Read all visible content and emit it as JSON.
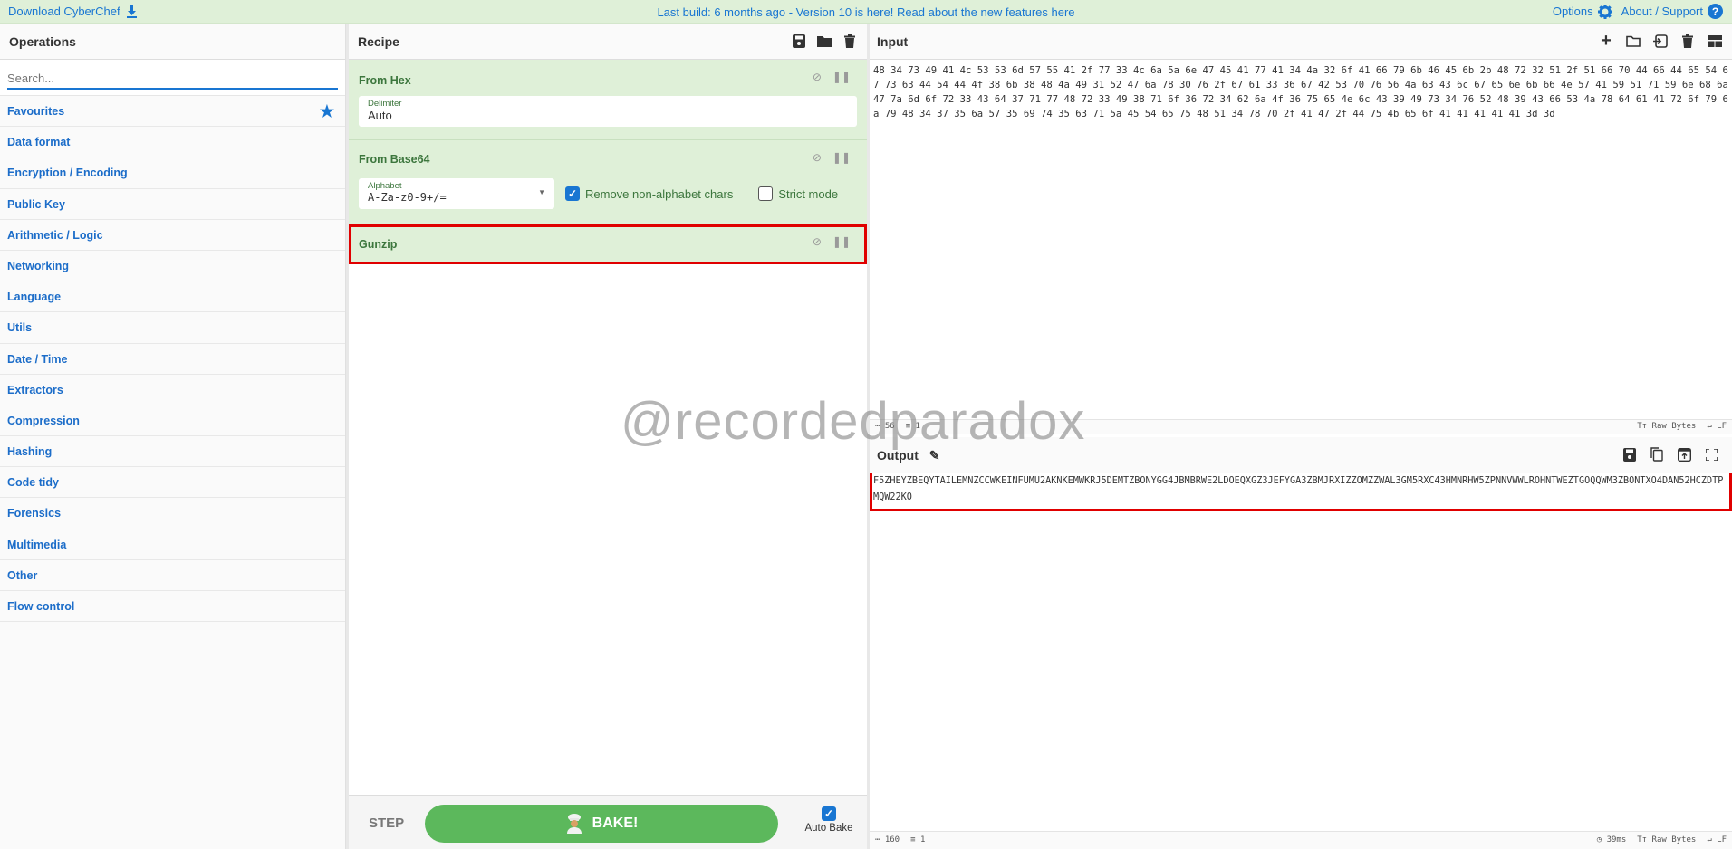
{
  "topbar": {
    "download_label": "Download CyberChef",
    "notice": "Last build: 6 months ago - Version 10 is here! Read about the new features here",
    "options_label": "Options",
    "about_label": "About / Support"
  },
  "operations": {
    "title": "Operations",
    "search_placeholder": "Search...",
    "categories": [
      {
        "label": "Favourites"
      },
      {
        "label": "Data format"
      },
      {
        "label": "Encryption / Encoding"
      },
      {
        "label": "Public Key"
      },
      {
        "label": "Arithmetic / Logic"
      },
      {
        "label": "Networking"
      },
      {
        "label": "Language"
      },
      {
        "label": "Utils"
      },
      {
        "label": "Date / Time"
      },
      {
        "label": "Extractors"
      },
      {
        "label": "Compression"
      },
      {
        "label": "Hashing"
      },
      {
        "label": "Code tidy"
      },
      {
        "label": "Forensics"
      },
      {
        "label": "Multimedia"
      },
      {
        "label": "Other"
      },
      {
        "label": "Flow control"
      }
    ]
  },
  "recipe": {
    "title": "Recipe",
    "ops": [
      {
        "name": "From Hex",
        "field_label": "Delimiter",
        "field_value": "Auto"
      },
      {
        "name": "From Base64",
        "field_label": "Alphabet",
        "field_value": "A-Za-z0-9+/=",
        "remove_label": "Remove non-alphabet chars",
        "remove_checked": true,
        "strict_label": "Strict mode",
        "strict_checked": false
      },
      {
        "name": "Gunzip"
      }
    ],
    "step_label": "STEP",
    "bake_label": "BAKE!",
    "auto_bake_label": "Auto Bake",
    "auto_bake_checked": true
  },
  "input": {
    "title": "Input",
    "text": "48 34 73 49 41 4c 53 53 6d 57 55 41 2f 77 33 4c 6a 5a 6e 47 45 41 77 41 34 4a 32 6f 41 66 79 6b 46 45 6b 2b 48 72 32 51 2f 51 66 70 44 66 44 65 54 67 73 63 44 54 44 4f 38 6b 38 48 4a 49 31 52 47 6a 78 30 76 2f 67 61 33 36 67 42 53 70 76 56 4a 63 43 6c 67 65 6e 6b 66 4e 57 41 59 51 71 59 6e 68 6a 47 7a 6d 6f 72 33 43 64 37 71 77 48 72 33 49 38 71 6f 36 72 34 62 6a 4f 36 75 65 4e 6c 43 39 49 73 34 76 52 48 39 43 66 53 4a 78 64 61 41 72 6f 79 6a 79 48 34 37 35 6a 57 35 69 74 35 63 71 5a 45 54 65 75 48 51 34 78 70 2f 41 47 2f 44 75 4b 65 6f 41 41 41 41 41 3d 3d",
    "status_length": "56",
    "status_lines": "1",
    "status_format": "Raw Bytes",
    "status_eol": "LF"
  },
  "output": {
    "title": "Output",
    "text": "F5ZHEYZBEQYTAILEMNZCCWKEINFUMU2AKNKEMWKRJ5DEMTZBONYGG4JBMBRWE2LDOEQXGZ3JEFYGA3ZBMJRXIZZOMZZWAL3GM5RXC43HMNRHW5ZPNNVWWLROHNTWEZTGOQQWM3ZBONTXO4DAN52HCZDTPMQW22KO",
    "status_length": "160",
    "status_lines": "1",
    "status_time": "39ms",
    "status_format": "Raw Bytes",
    "status_eol": "LF"
  },
  "watermark": "@recordedparadox",
  "colors": {
    "accent": "#1976d2",
    "recipe_bg": "#dff0d8",
    "recipe_text": "#3c763d",
    "bake": "#5cb85c",
    "highlight": "#e00000"
  }
}
